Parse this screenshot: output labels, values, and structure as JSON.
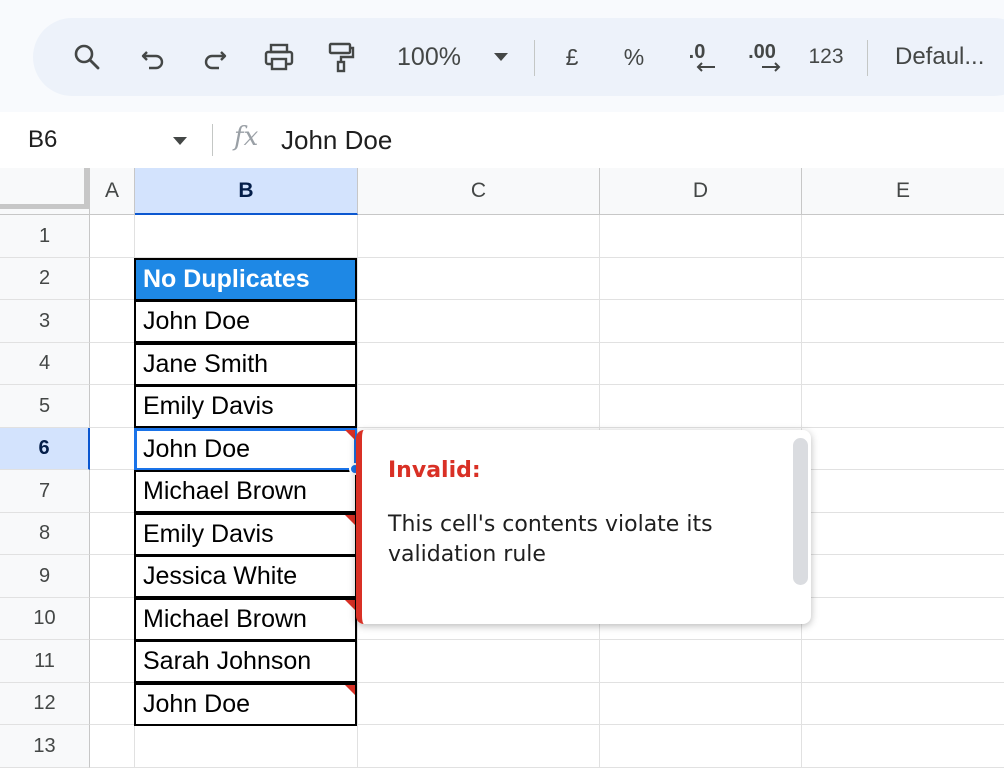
{
  "toolbar": {
    "zoom": "100%",
    "currency": "£",
    "percent": "%",
    "decrease_decimal": ".0",
    "increase_decimal": ".00",
    "number_format": "123",
    "font": "Defaul..."
  },
  "formula_bar": {
    "name_box": "B6",
    "fx": "fx",
    "value": "John Doe"
  },
  "columns": [
    "A",
    "B",
    "C",
    "D",
    "E"
  ],
  "rows": [
    "1",
    "2",
    "3",
    "4",
    "5",
    "6",
    "7",
    "8",
    "9",
    "10",
    "11",
    "12",
    "13"
  ],
  "selected_cell": "B6",
  "cells": {
    "B2": "No Duplicates",
    "B3": "John Doe",
    "B4": "Jane Smith",
    "B5": "Emily Davis",
    "B6": "John Doe",
    "B7": "Michael Brown",
    "B8": "Emily Davis",
    "B9": "Jessica White",
    "B10": "Michael Brown",
    "B11": "Sarah Johnson",
    "B12": "John Doe"
  },
  "validation_popup": {
    "title": "Invalid:",
    "message": "This cell's contents violate its validation rule"
  },
  "colors": {
    "header_fill": "#1e88e5",
    "error": "#d93025",
    "selection": "#1a73e8"
  }
}
